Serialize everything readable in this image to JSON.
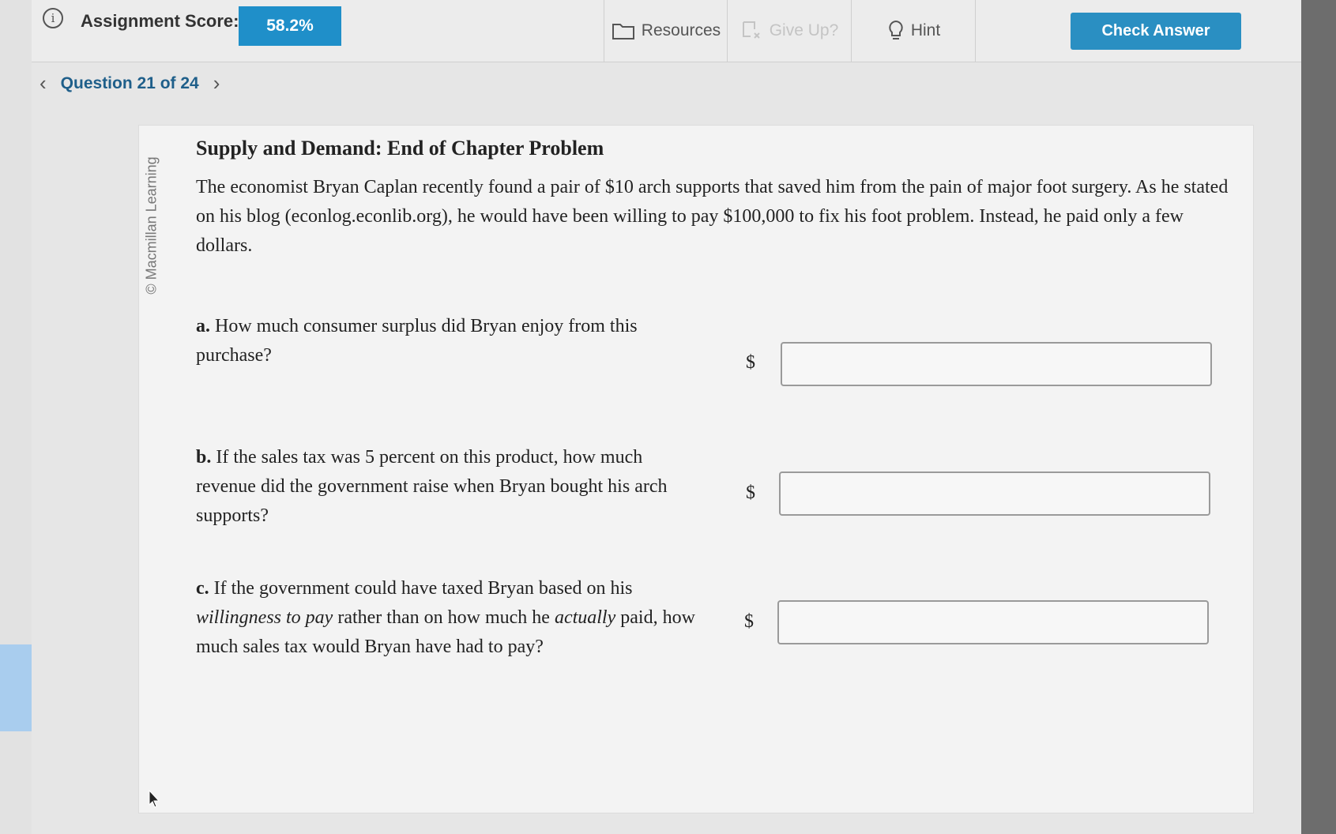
{
  "header": {
    "score_label": "Assignment Score:",
    "score_value": "58.2%",
    "resources_label": "Resources",
    "giveup_label": "Give Up?",
    "hint_label": "Hint",
    "check_answer_label": "Check Answer"
  },
  "question_nav": {
    "label": "Question 21 of 24"
  },
  "problem": {
    "credit": "© Macmillan Learning",
    "title": "Supply and Demand: End of Chapter Problem",
    "intro": "The economist Bryan Caplan recently found a pair of $10 arch supports that saved him from the pain of major foot surgery. As he stated on his blog (econlog.econlib.org), he would have been willing to pay $100,000 to fix his foot problem. Instead, he paid only a few dollars.",
    "questions": [
      {
        "letter": "a.",
        "text": "How much consumer surplus did Bryan enjoy from this purchase?",
        "currency": "$",
        "answer": ""
      },
      {
        "letter": "b.",
        "text": "If the sales tax was 5 percent on this product, how much revenue did the government raise when Bryan bought his arch supports?",
        "currency": "$",
        "answer": ""
      },
      {
        "letter": "c.",
        "text_before": "If the government could have taxed Bryan based on his ",
        "em1": "willingness to pay",
        "text_mid": " rather than on how much he ",
        "em2": "actually",
        "text_after": " paid, how much sales tax would Bryan have had to pay?",
        "currency": "$",
        "answer": ""
      }
    ]
  },
  "colors": {
    "accent_blue": "#1f8fc9",
    "check_button": "#2a8fc2",
    "nav_text": "#1f5f8a"
  }
}
